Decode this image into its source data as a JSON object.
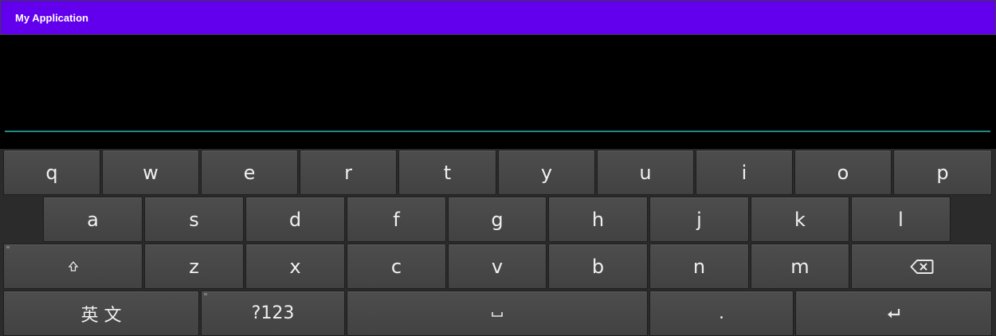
{
  "app": {
    "title": "My Application"
  },
  "colors": {
    "app_bar": "#6200ee",
    "input_underline": "#1f8c86",
    "key_bg": "#474747",
    "keyboard_bg": "#2b2b2b"
  },
  "keyboard": {
    "row1": [
      "q",
      "w",
      "e",
      "r",
      "t",
      "y",
      "u",
      "i",
      "o",
      "p"
    ],
    "row2": [
      "a",
      "s",
      "d",
      "f",
      "g",
      "h",
      "j",
      "k",
      "l"
    ],
    "row3": [
      "z",
      "x",
      "c",
      "v",
      "b",
      "n",
      "m"
    ],
    "language_label": "英 文",
    "symbols_label": "?123",
    "period_label": ".",
    "icons": {
      "shift": "shift-icon",
      "backspace": "backspace-icon",
      "space": "space-icon",
      "enter": "enter-icon"
    }
  }
}
